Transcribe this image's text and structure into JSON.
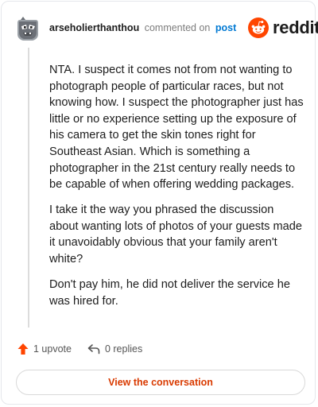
{
  "header": {
    "username": "arseholierthanthou",
    "action_text": "commented on",
    "link_text": "post",
    "brand_word": "reddit"
  },
  "comment": {
    "paragraphs": [
      "NTA. I suspect it comes not from not wanting to photograph people of particular races, but not knowing how. I suspect the photographer just has little or no experience setting up the exposure of his camera to get the skin tones right for Southeast Asian. Which is something a photographer in the 21st century really needs to be capable of when offering wedding packages.",
      "I take it the way you phrased the discussion about wanting lots of photos of your guests made it unavoidably obvious that your family aren't white?",
      "Don't pay him, he did not deliver the service he was hired for."
    ]
  },
  "actions": {
    "upvote_label": "1 upvote",
    "replies_label": "0 replies"
  },
  "cta": {
    "label": "View the conversation"
  },
  "icons": {
    "avatar": "snoo-avatar-icon",
    "brand": "reddit-logo-icon",
    "upvote": "upvote-arrow-icon",
    "reply": "reply-arrow-icon"
  },
  "colors": {
    "brand_orange": "#ff4500",
    "upvote": "#ff4500",
    "link_blue": "#0079d3",
    "cta_text": "#d93a00"
  }
}
